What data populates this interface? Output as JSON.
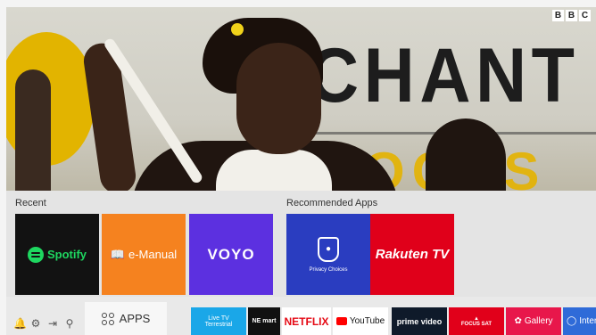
{
  "broadcast": {
    "channel_logo": [
      "B",
      "B",
      "C"
    ],
    "banner_text": "CHANT",
    "banner_sub": "OCCS"
  },
  "recent": {
    "label": "Recent",
    "apps": [
      {
        "name": "Spotify",
        "color": "#121212"
      },
      {
        "name": "e-Manual",
        "color": "#f5821f"
      },
      {
        "name": "VOYO",
        "color": "#5c30e0"
      }
    ]
  },
  "recommended": {
    "label": "Recommended Apps",
    "apps": [
      {
        "name": "Privacy Choices",
        "color": "#2a3dc0"
      },
      {
        "name": "Rakuten TV",
        "color": "#e0001a"
      }
    ]
  },
  "bottom_bar": {
    "system_icons": [
      "notification-icon",
      "settings-icon",
      "source-icon",
      "search-icon"
    ],
    "apps_label": "APPS",
    "apps": [
      {
        "title": "Live TV",
        "subtitle": "Terrestrial",
        "color": "#1aa7e8"
      },
      {
        "title": "NE mart",
        "color": "#111111"
      },
      {
        "title": "NETFLIX",
        "color": "#ffffff"
      },
      {
        "title": "YouTube",
        "color": "#ffffff"
      },
      {
        "title": "prime video",
        "color": "#0f1a2a"
      },
      {
        "title": "FOCUS SAT",
        "color": "#e1001a"
      },
      {
        "title": "Gallery",
        "color": "#e8174b"
      },
      {
        "title": "Inter",
        "color": "#2f6bd8"
      }
    ]
  }
}
